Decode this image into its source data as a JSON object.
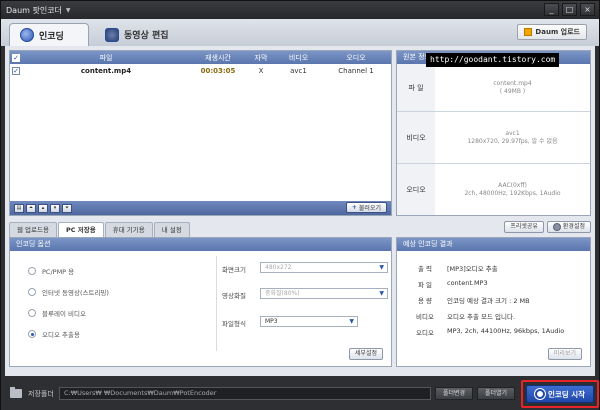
{
  "window": {
    "title": "Daum 팟인코더",
    "title_caret": "▼",
    "min": "_",
    "max": "□",
    "close": "×"
  },
  "tabs": [
    {
      "label": "인코딩"
    },
    {
      "label": "동영상 편집"
    }
  ],
  "daum_upload": "Daum 업로드",
  "file_table": {
    "headers": [
      "파일",
      "재생시간",
      "자막",
      "비디오",
      "오디오"
    ],
    "rows": [
      {
        "checked": true,
        "file": "content.mp4",
        "duration": "00:03:05",
        "subtitle": "X",
        "video": "avc1",
        "audio": "Channel 1"
      }
    ],
    "add_button": "불러오기"
  },
  "original_info": {
    "header": "원본 정보",
    "rows": [
      {
        "label": "파 일",
        "lines": [
          "content.mp4",
          "( 49MB )"
        ]
      },
      {
        "label": "비디오",
        "lines": [
          "avc1",
          "1280x720, 29.97fps, 알 수 없음"
        ]
      },
      {
        "label": "오디오",
        "lines": [
          "AAC(0xff)",
          "2ch, 48000Hz, 192Kbps, 1Audio"
        ]
      }
    ]
  },
  "subtabs": [
    "웹 업로드용",
    "PC 저장용",
    "휴대 기기용",
    "내 설정"
  ],
  "preset_share": "프리셋공유",
  "env_settings": "환경설정",
  "encoding_options": {
    "header": "인코딩 옵션",
    "radios": [
      {
        "label": "PC/PMP 용",
        "selected": false
      },
      {
        "label": "인터넷 동영상(스트리밍)",
        "selected": false
      },
      {
        "label": "블루레이 비디오",
        "selected": false
      },
      {
        "label": "오디오 추출용",
        "selected": true
      }
    ],
    "screen_size_label": "화면크기",
    "screen_size_value": "480x272",
    "quality_label": "영상화질",
    "quality_value": "중화질(80%)",
    "format_label": "파일형식",
    "format_value": "MP3",
    "detail_button": "세부설정"
  },
  "expected_result": {
    "header": "예상 인코딩 결과",
    "rows": [
      {
        "k": "출 력",
        "v": "[MP3]오디오 추출"
      },
      {
        "k": "파 일",
        "v": "content.MP3"
      },
      {
        "k": "용 량",
        "v": "인코딩 예상 결과 크기 : 2 MB"
      },
      {
        "k": "비디오",
        "v": "오디오 추출 모드 입니다."
      },
      {
        "k": "오디오",
        "v": "MP3, 2ch, 44100Hz, 96kbps, 1Audio"
      }
    ],
    "preview_button": "미리보기"
  },
  "save_folder": {
    "label": "저장폴더",
    "path": "C:₩Users₩          ₩Documents₩Daum₩PotEncoder",
    "change_button": "폴더변경",
    "open_button": "폴더열기"
  },
  "start_button": "인코딩 시작",
  "watermark": "http://goodant.tistory.com"
}
